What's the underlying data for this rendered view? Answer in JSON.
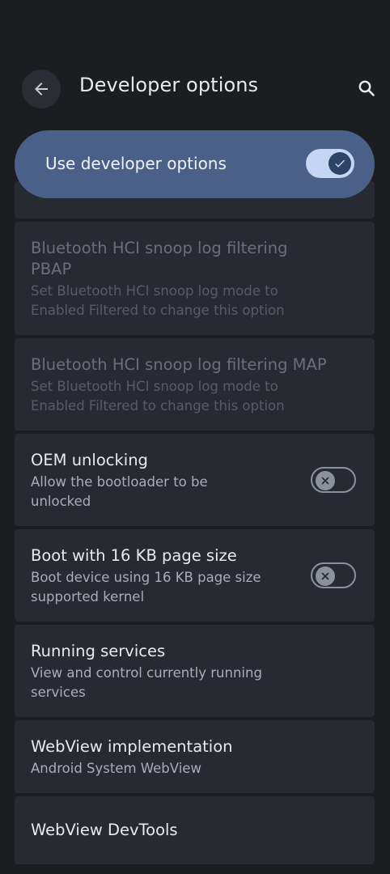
{
  "header": {
    "title": "Developer options"
  },
  "master_switch": {
    "label": "Use developer options",
    "checked": true
  },
  "settings": [
    {
      "title_lines": [
        "Bluetooth HCI snoop log filtering",
        "PBAP"
      ],
      "subtitle_lines": [
        "Set Bluetooth HCI snoop log mode to",
        "Enabled Filtered to change this option"
      ],
      "enabled": false
    },
    {
      "title_lines": [
        "Bluetooth HCI snoop log filtering MAP"
      ],
      "subtitle_lines": [
        "Set Bluetooth HCI snoop log mode to",
        "Enabled Filtered to change this option"
      ],
      "enabled": false
    },
    {
      "title_lines": [
        "OEM unlocking"
      ],
      "subtitle_lines": [
        "Allow the bootloader to be",
        "unlocked"
      ],
      "toggle": false
    },
    {
      "title_lines": [
        "Boot with 16 KB page size"
      ],
      "subtitle_lines": [
        "Boot device using 16 KB page size",
        "supported kernel"
      ],
      "toggle": false
    },
    {
      "title_lines": [
        "Running services"
      ],
      "subtitle_lines": [
        "View and control currently running",
        "services"
      ]
    },
    {
      "title_lines": [
        "WebView implementation"
      ],
      "subtitle_lines": [
        "Android System WebView"
      ]
    },
    {
      "title_lines": [
        "WebView DevTools"
      ]
    }
  ],
  "icons": {
    "back": "arrow-back-icon",
    "search": "search-icon",
    "toggle_on": "check-icon",
    "toggle_off": "close-icon"
  }
}
